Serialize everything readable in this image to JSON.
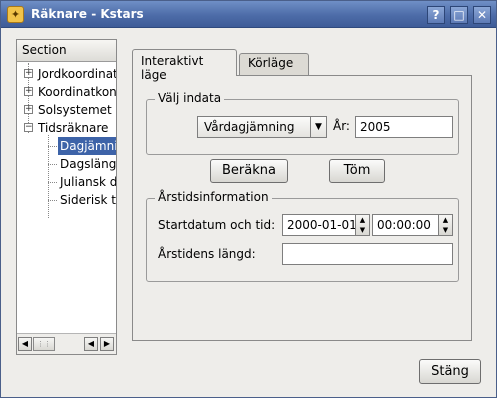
{
  "window": {
    "title": "Räknare - Kstars"
  },
  "sidebar": {
    "header": "Section",
    "items": [
      {
        "label": "Jordkoordinat",
        "expander": "+"
      },
      {
        "label": "Koordinatkon",
        "expander": "+"
      },
      {
        "label": "Solsystemet",
        "expander": "+"
      },
      {
        "label": "Tidsräknare",
        "expander": "−"
      }
    ],
    "children": [
      {
        "label": "Dagjämni"
      },
      {
        "label": "Dagslängd"
      },
      {
        "label": "Juliansk d"
      },
      {
        "label": "Siderisk t"
      }
    ]
  },
  "tabs": [
    {
      "label": "Interaktivt läge"
    },
    {
      "label": "Körläge"
    }
  ],
  "input_group": {
    "title": "Välj indata",
    "event_select": "Vårdagjämning",
    "year_label": "År:",
    "year_value": "2005"
  },
  "buttons": {
    "compute": "Beräkna",
    "clear": "Töm",
    "close": "Stäng"
  },
  "season_group": {
    "title": "Årstidsinformation",
    "start_label": "Startdatum och tid:",
    "start_date": "2000-01-01",
    "start_time": "00:00:00",
    "length_label": "Årstidens längd:",
    "length_value": ""
  }
}
